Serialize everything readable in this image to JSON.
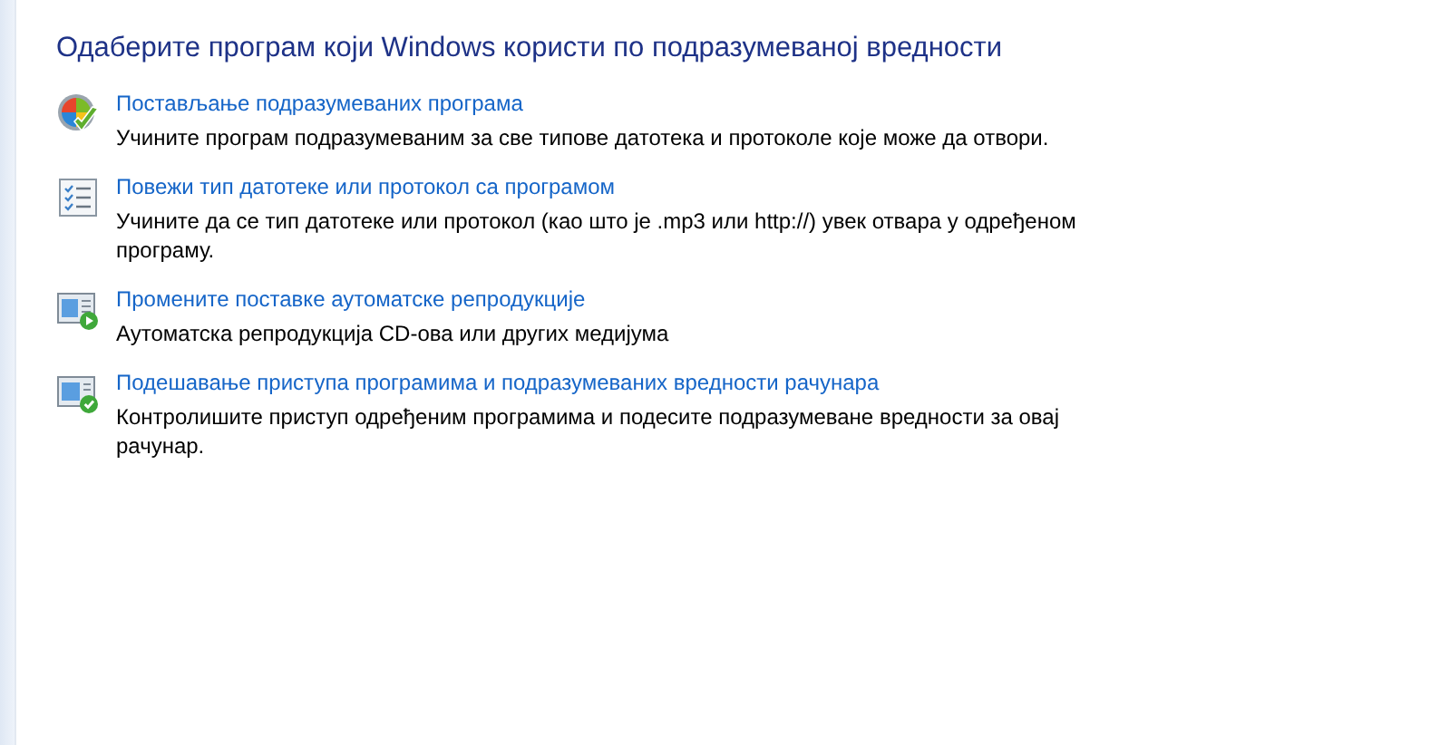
{
  "heading": "Одаберите програм који Windows користи по подразумеваној вредности",
  "items": [
    {
      "kind": "defaults",
      "link": "Постављање подразумеваних програма",
      "description": "Учините програм подразумеваним за све типове датотека и протоколе које може да отвори."
    },
    {
      "kind": "associate",
      "link": "Повежи тип датотеке или протокол са програмом",
      "description": "Учините да се тип датотеке или протокол (као што је .mp3 или http://) увек отвара у одређеном програму."
    },
    {
      "kind": "autoplay",
      "link": "Промените поставке аутоматске репродукције",
      "description": "Аутоматска репродукција CD-ова или других медијума"
    },
    {
      "kind": "access",
      "link": "Подешавање приступа програмима и подразумеваних вредности рачунара",
      "description": "Контролишите приступ одређеним програмима и подесите подразумеване вредности за овај рачунар."
    }
  ]
}
